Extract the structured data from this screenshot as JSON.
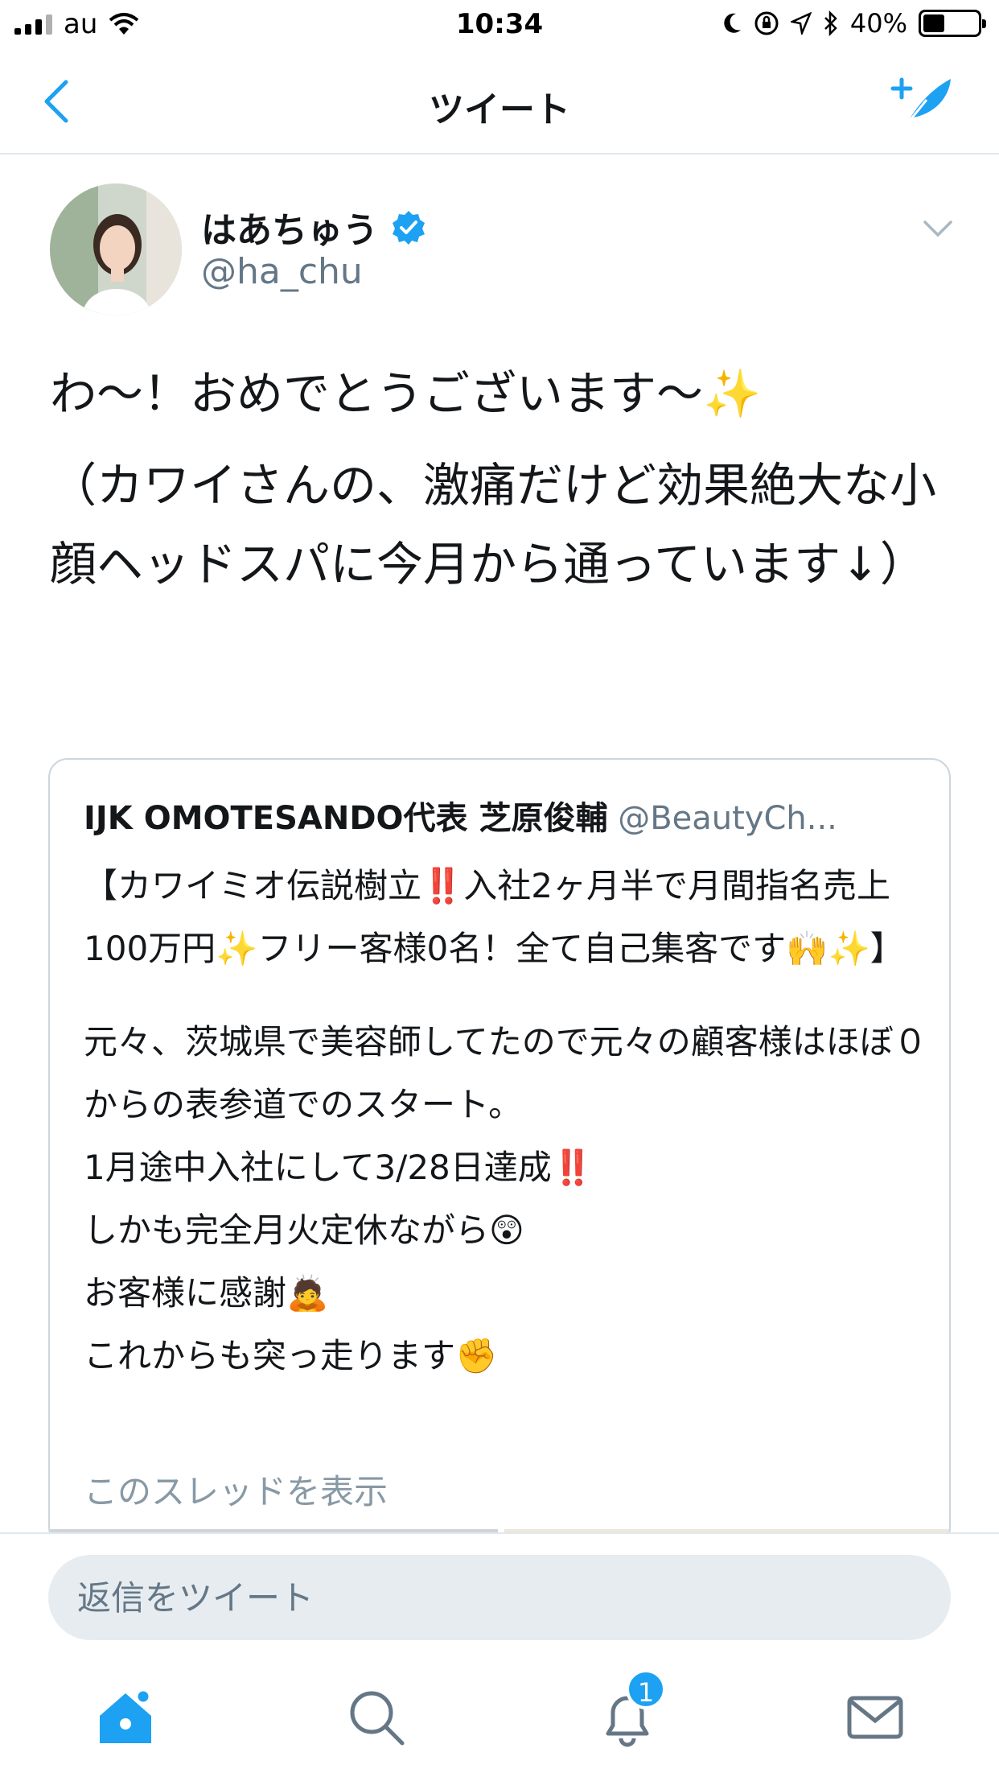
{
  "status_bar": {
    "carrier": "au",
    "time": "10:34",
    "battery": "40%",
    "battery_level": 0.4
  },
  "nav": {
    "title": "ツイート",
    "back_icon": "chevron-left-icon",
    "compose_icon": "compose-tweet-icon"
  },
  "tweet": {
    "name": "はあちゅう",
    "handle": "@ha_chu",
    "verified": true,
    "text": [
      "わ〜！おめでとうございます〜✨",
      "（カワイさんの、激痛だけど効果絶大な小顔ヘッドスパに今月から通っています↓）"
    ]
  },
  "quoted_tweet": {
    "name": "IJK OMOTESANDO代表 芝原俊輔",
    "handle": "@BeautyCh...",
    "text_first": "【カワイミオ伝説樹立‼️入社2ヶ月半で月間指名売上100万円✨フリー客様0名！全て自己集客です🙌✨】",
    "lines": [
      "元々、茨城県で美容師してたので元々の顧客様はほぼ０からの表参道でのスタート。",
      "1月途中入社にして3/28日達成‼️",
      "しかも完全月火定休ながら😲",
      "お客様に感謝🙇",
      "これからも突っ走ります✊"
    ],
    "thread_link": "このスレッドを表示"
  },
  "reply": {
    "placeholder": "返信をツイート"
  },
  "tabs": {
    "home_icon": "home-icon",
    "search_icon": "search-icon",
    "notifications_icon": "bell-icon",
    "notifications_badge": "1",
    "messages_icon": "mail-icon"
  },
  "colors": {
    "accent": "#1da1f2",
    "text": "#14171a",
    "secondary": "#657786",
    "border": "#e1e8ed"
  }
}
